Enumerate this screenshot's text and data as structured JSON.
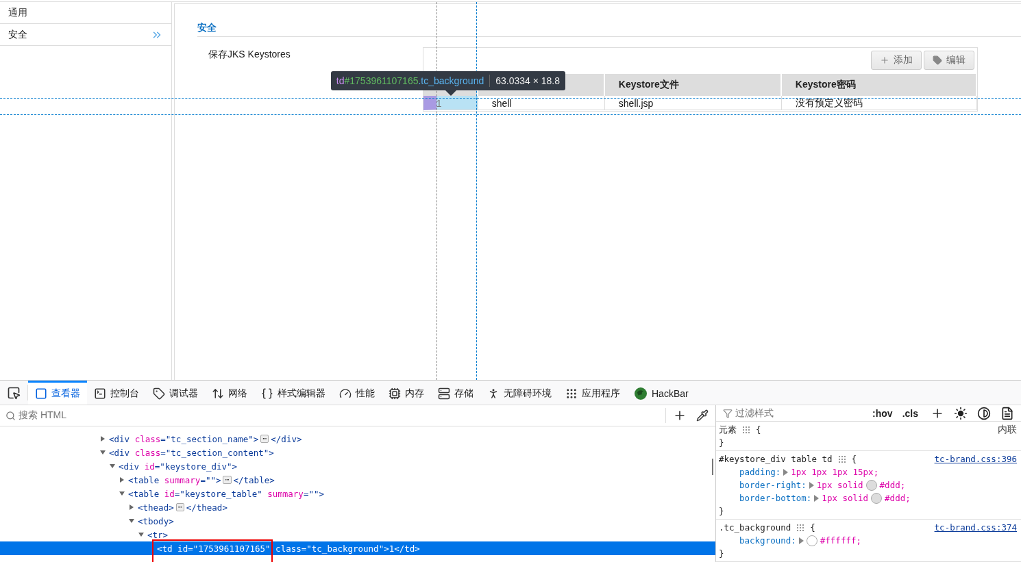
{
  "sidebar": {
    "items": [
      {
        "label": "通用",
        "selected": false
      },
      {
        "label": "安全",
        "selected": true
      }
    ]
  },
  "section": {
    "title": "安全",
    "field_label": "保存JKS Keystores"
  },
  "keystore_table": {
    "buttons": [
      {
        "label": "添加",
        "kind": "add"
      },
      {
        "label": "编辑",
        "kind": "edit"
      }
    ],
    "columns": [
      "",
      "",
      "Keystore文件",
      "Keystore密码"
    ],
    "rows": [
      {
        "cells": [
          {
            "text": "1",
            "highlighted": true
          },
          {
            "text": "shell",
            "highlighted": false
          },
          {
            "text": "shell.jsp",
            "highlighted": false
          },
          {
            "text": "没有预定义密码",
            "highlighted": false
          }
        ]
      }
    ]
  },
  "inspector_tooltip": {
    "tag": "td",
    "id": "#1753961107165",
    "class": ".tc_background",
    "size": "63.0334 × 18.8"
  },
  "devtools": {
    "tabs": [
      {
        "label": "查看器",
        "selected": true
      },
      {
        "label": "控制台",
        "selected": false
      },
      {
        "label": "调试器",
        "selected": false
      },
      {
        "label": "网络",
        "selected": false
      },
      {
        "label": "样式编辑器",
        "selected": false
      },
      {
        "label": "性能",
        "selected": false
      },
      {
        "label": "内存",
        "selected": false
      },
      {
        "label": "存储",
        "selected": false
      },
      {
        "label": "无障碍环境",
        "selected": false
      },
      {
        "label": "应用程序",
        "selected": false
      },
      {
        "label": "HackBar",
        "selected": false
      }
    ],
    "html_search": {
      "placeholder": "搜索 HTML"
    },
    "markup": [
      {
        "tokens": [
          {
            "kind": "tag",
            "text": "<div "
          },
          {
            "kind": "attr",
            "text": "class"
          },
          {
            "kind": "tag",
            "text": "=\"tc_section_name\">"
          },
          {
            "kind": "badge",
            "text": "⋯"
          },
          {
            "kind": "tag",
            "text": "</div>"
          }
        ],
        "expanded": false,
        "selected": false
      },
      {
        "tokens": [
          {
            "kind": "tag",
            "text": "<div "
          },
          {
            "kind": "attr",
            "text": "class"
          },
          {
            "kind": "tag",
            "text": "=\"tc_section_content\">"
          }
        ],
        "expanded": true,
        "selected": false,
        "children": [
          {
            "tokens": [
              {
                "kind": "tag",
                "text": "<div "
              },
              {
                "kind": "attr",
                "text": "id"
              },
              {
                "kind": "tag",
                "text": "=\"keystore_div\">"
              }
            ],
            "expanded": true,
            "selected": false,
            "children": [
              {
                "tokens": [
                  {
                    "kind": "tag",
                    "text": "<table "
                  },
                  {
                    "kind": "attr",
                    "text": "summary"
                  },
                  {
                    "kind": "tag",
                    "text": "=\"\">"
                  },
                  {
                    "kind": "badge",
                    "text": "⋯"
                  },
                  {
                    "kind": "tag",
                    "text": "</table>"
                  }
                ],
                "expanded": false,
                "selected": false
              },
              {
                "tokens": [
                  {
                    "kind": "tag",
                    "text": "<table "
                  },
                  {
                    "kind": "attr",
                    "text": "id"
                  },
                  {
                    "kind": "tag",
                    "text": "=\"keystore_table\" "
                  },
                  {
                    "kind": "attr",
                    "text": "summary"
                  },
                  {
                    "kind": "tag",
                    "text": "=\"\">"
                  }
                ],
                "expanded": true,
                "selected": false,
                "children": [
                  {
                    "tokens": [
                      {
                        "kind": "tag",
                        "text": "<thead>"
                      },
                      {
                        "kind": "badge",
                        "text": "⋯"
                      },
                      {
                        "kind": "tag",
                        "text": "</thead>"
                      }
                    ],
                    "expanded": false,
                    "selected": false
                  },
                  {
                    "tokens": [
                      {
                        "kind": "tag",
                        "text": "<tbody>"
                      }
                    ],
                    "expanded": true,
                    "selected": false,
                    "children": [
                      {
                        "tokens": [
                          {
                            "kind": "tag",
                            "text": "<tr>"
                          }
                        ],
                        "expanded": true,
                        "selected": false,
                        "children": [
                          {
                            "tokens": [
                              {
                                "text": "<td "
                              },
                              {
                                "text": "id"
                              },
                              {
                                "text": "=\"1753961107165\" "
                              },
                              {
                                "text": "class"
                              },
                              {
                                "text": "=\"tc_background\">1</td>"
                              }
                            ],
                            "selected": true
                          }
                        ]
                      }
                    ]
                  }
                ]
              }
            ]
          }
        ]
      }
    ],
    "styles_filter": {
      "placeholder": "过滤样式"
    },
    "style_toggles": [
      ":hov",
      ".cls"
    ],
    "rules": [
      {
        "selector": "元素",
        "open": "{",
        "close": "}",
        "source": "内联",
        "source_is_link": false
      },
      {
        "selector": "#keystore_div table td",
        "open": "{",
        "close": "}",
        "source": "tc-brand.css:396",
        "source_is_link": true,
        "declarations": [
          {
            "property": "padding:",
            "value": "1px 1px 1px 15px;"
          },
          {
            "property": "border-right:",
            "value": "1px solid",
            "color": "#dddddd",
            "color_text": "#ddd;"
          },
          {
            "property": "border-bottom:",
            "value": "1px solid",
            "color": "#dddddd",
            "color_text": "#ddd;"
          }
        ]
      },
      {
        "selector": ".tc_background",
        "open": "{",
        "close": "}",
        "source": "tc-brand.css:374",
        "source_is_link": true,
        "declarations": [
          {
            "property": "background:",
            "color": "#ffffff",
            "color_text": "#ffffff;"
          }
        ]
      }
    ]
  }
}
